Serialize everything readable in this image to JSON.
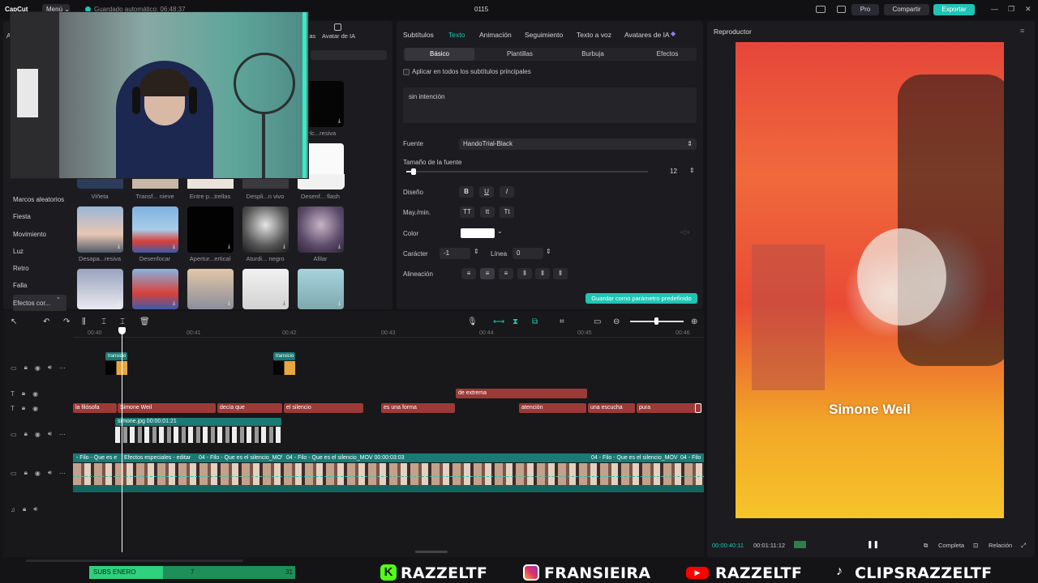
{
  "topbar": {
    "logo": "CapCut",
    "menu": "Menú ⌄",
    "autosave": "Guardado automático: 06:48:37",
    "title": "0115",
    "pro": "Pro",
    "share": "Compartir",
    "export": "Exportar"
  },
  "media": {
    "tab_ia": "Avatar de IA",
    "tab_partial": "llas",
    "top_labels": [
      "Viñeta",
      "Transf... nieve",
      "Entre p...trellas",
      "Despli...n vivo",
      "Desenf... flash"
    ],
    "mid_labels": [
      "Desapa...resiva",
      "Desenfocar",
      "Apertur...ertical",
      "Aturdi... negro",
      "Afilar"
    ],
    "right_label": "arlc...resiva",
    "categories": [
      "Marcos aleatorios",
      "Fiesta",
      "Movimiento",
      "Luz",
      "Retro",
      "Falla",
      "Efectos cor..."
    ]
  },
  "props": {
    "tabs": [
      "Subtítulos",
      "Texto",
      "Animación",
      "Seguimiento",
      "Texto a voz",
      "Avatares de IA"
    ],
    "active_tab": "Texto",
    "subtabs": [
      "Básico",
      "Plantillas",
      "Burbuja",
      "Efectos"
    ],
    "apply_all": "Aplicar en todos los subtítulos principales",
    "text_value": "sin intención",
    "font_label": "Fuente",
    "font_value": "HandoTrial-Black",
    "size_label": "Tamaño de la fuente",
    "size_value": "12",
    "size_fraction": 0.03,
    "design_label": "Diseño",
    "case_label": "May./min.",
    "case_opts": [
      "TT",
      "tt",
      "Tt"
    ],
    "color_label": "Color",
    "color_value": "#ffffff",
    "char_label": "Carácter",
    "char_value": "-1",
    "line_label": "Línea",
    "line_value": "0",
    "align_label": "Alineación",
    "save_preset": "Guardar como parámetro predefinido"
  },
  "player": {
    "title": "Reproductor",
    "overlay_text": "Simone Weil",
    "current_time": "00:00:40:11",
    "total_time": "00:01:11:12",
    "full": "Completa",
    "ratio": "Relación"
  },
  "timeline": {
    "ruler": [
      "00:40",
      "00:41",
      "00:42",
      "00:43",
      "00:44",
      "00:45",
      "00:46"
    ],
    "transition_label": "transicio",
    "upper_text": "de extrema",
    "text_clips": [
      "la filósofa",
      "Simone Weil",
      "decía que",
      "el silencio",
      "es una forma",
      "atención",
      "una escucha",
      "pura"
    ],
    "image_clip": "simone.jpg  00:00:01:21",
    "video_labels": [
      "- Filo - Que es e",
      "Efectos especiales - editar",
      "04 - Filo - Que es el silencio_MOV",
      "04 - Filo - Que es el silencio_MOV  00:00:03:03",
      "04 - Filo - Que es el silencio_MOV",
      "04 - Filo"
    ]
  },
  "overlay_bar": {
    "subs_label": "SUBS ENERO",
    "subs_current": "7",
    "subs_goal": "31",
    "subs_fraction": 0.36,
    "socials": [
      "RAZZELTF",
      "FRANSIEIRA",
      "RAZZELTF",
      "CLIPSRAZZELTF"
    ]
  },
  "colors": {
    "accent": "#20c4b5",
    "text_clip": "#9b3a37",
    "kick": "#53fc18",
    "youtube": "#ff0000"
  }
}
